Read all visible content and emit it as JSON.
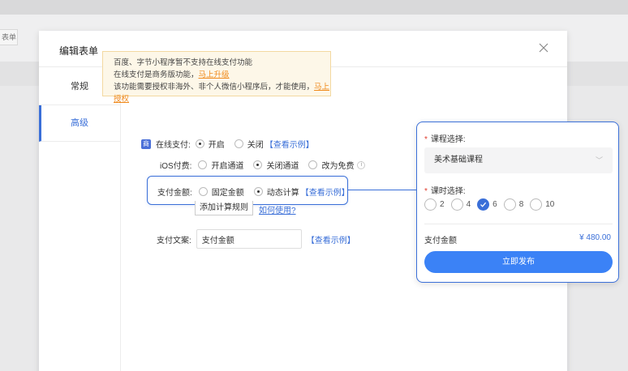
{
  "background": {
    "button_label": "表单"
  },
  "modal": {
    "title": "编辑表单",
    "tabs": [
      {
        "label": "常规"
      },
      {
        "label": "高级"
      }
    ]
  },
  "notice": {
    "line1": "百度、字节小程序暂不支持在线支付功能",
    "line2_text": "在线支付是商务版功能，",
    "line2_link": "马上升级",
    "line3_text": "该功能需要授权非海外、非个人微信小程序后，才能使用，",
    "line3_link": "马上授权"
  },
  "online_pay": {
    "badge": "商",
    "label": "在线支付:",
    "options": [
      "开启",
      "关闭"
    ],
    "selected": "开启",
    "example_link": "【查看示例】"
  },
  "ios_pay": {
    "label": "iOS付费:",
    "options": [
      "开启通道",
      "关闭通道",
      "改为免费"
    ],
    "selected": "关闭通道",
    "info": "i"
  },
  "pay_amount": {
    "label": "支付金额:",
    "options": [
      "固定金额",
      "动态计算"
    ],
    "selected": "动态计算",
    "example_link": "【查看示例】"
  },
  "rules": {
    "add_button": "添加计算规则",
    "how_link": "如何使用?"
  },
  "pay_text": {
    "label": "支付文案:",
    "value": "支付金额",
    "example_link": "【查看示例】"
  },
  "preview_card": {
    "course_label": "课程选择:",
    "course_value": "美术基础课程",
    "hours_label": "课时选择:",
    "hours": [
      "2",
      "4",
      "6",
      "8",
      "10"
    ],
    "hours_selected": "6",
    "amount_label": "支付金额",
    "amount_value": "¥ 480.00",
    "publish_button": "立即发布",
    "required_mark": "*"
  },
  "colors": {
    "accent": "#3a6fd8",
    "publish": "#3b82f6",
    "warning_link": "#f08a1c",
    "notice_bg": "#fdf7e8"
  }
}
